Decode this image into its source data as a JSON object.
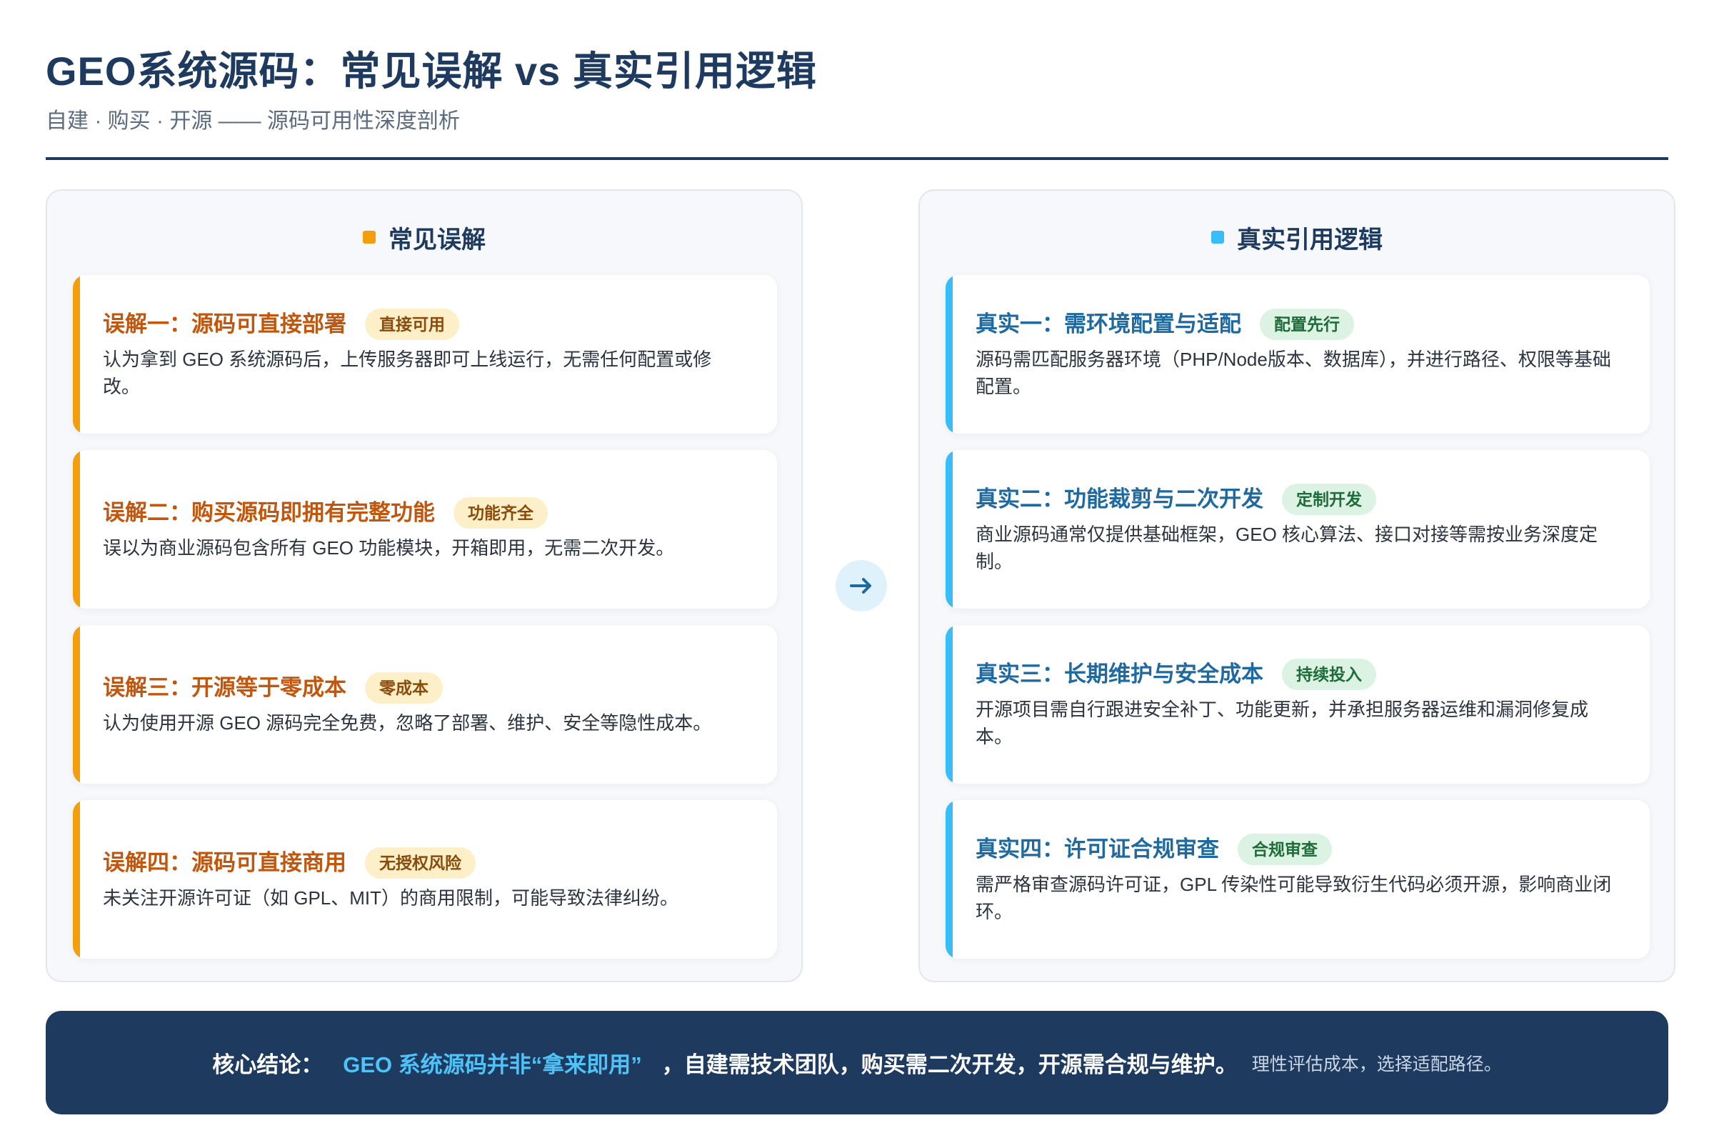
{
  "header": {
    "title": "GEO系统源码：常见误解 vs 真实引用逻辑",
    "subtitle": "自建 · 购买 · 开源 —— 源码可用性深度剖析"
  },
  "left": {
    "title": "常见误解",
    "cards": [
      {
        "title": "误解一：源码可直接部署",
        "badge": "直接可用",
        "desc": "认为拿到 GEO 系统源码后，上传服务器即可上线运行，无需任何配置或修改。"
      },
      {
        "title": "误解二：购买源码即拥有完整功能",
        "badge": "功能齐全",
        "desc": "误以为商业源码包含所有 GEO 功能模块，开箱即用，无需二次开发。"
      },
      {
        "title": "误解三：开源等于零成本",
        "badge": "零成本",
        "desc": "认为使用开源 GEO 源码完全免费，忽略了部署、维护、安全等隐性成本。"
      },
      {
        "title": "误解四：源码可直接商用",
        "badge": "无授权风险",
        "desc": "未关注开源许可证（如 GPL、MIT）的商用限制，可能导致法律纠纷。"
      }
    ]
  },
  "right": {
    "title": "真实引用逻辑",
    "cards": [
      {
        "title": "真实一：需环境配置与适配",
        "badge": "配置先行",
        "desc": "源码需匹配服务器环境（PHP/Node版本、数据库），并进行路径、权限等基础配置。"
      },
      {
        "title": "真实二：功能裁剪与二次开发",
        "badge": "定制开发",
        "desc": "商业源码通常仅提供基础框架，GEO 核心算法、接口对接等需按业务深度定制。"
      },
      {
        "title": "真实三：长期维护与安全成本",
        "badge": "持续投入",
        "desc": "开源项目需自行跟进安全补丁、功能更新，并承担服务器运维和漏洞修复成本。"
      },
      {
        "title": "真实四：许可证合规审查",
        "badge": "合规审查",
        "desc": "需严格审查源码许可证，GPL 传染性可能导致衍生代码必须开源，影响商业闭环。"
      }
    ]
  },
  "footer": {
    "label": "核心结论：",
    "highlight": "GEO 系统源码并非“拿来即用”",
    "main": "，自建需技术团队，购买需二次开发，开源需合规与维护。",
    "note": "理性评估成本，选择适配路径。"
  },
  "colors": {
    "navy": "#1e3a5f",
    "amber": "#f59e0b",
    "sky": "#38bdf8"
  },
  "icons": {
    "arrow": "arrow-right-icon"
  }
}
